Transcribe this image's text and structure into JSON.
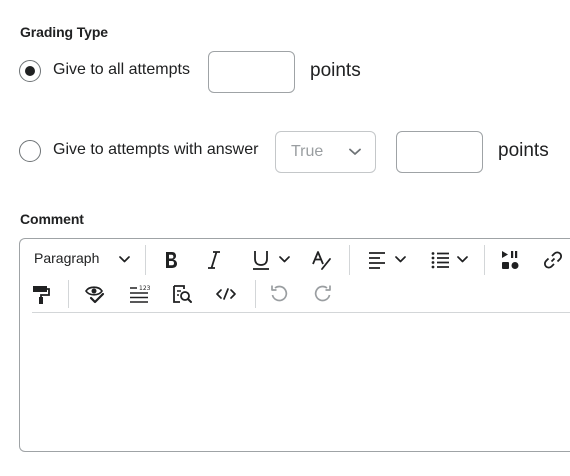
{
  "grading": {
    "title": "Grading Type",
    "options": [
      {
        "label": "Give to all attempts",
        "selected": true,
        "points_value": "",
        "points_unit": "points"
      },
      {
        "label": "Give to attempts with answer",
        "selected": false,
        "answer_select": "True",
        "points_value": "",
        "points_unit": "points"
      }
    ]
  },
  "comment": {
    "title": "Comment",
    "toolbar": {
      "paragraph_label": "Paragraph",
      "row1_icons": [
        "bold-icon",
        "italic-icon",
        "underline-icon",
        "format-clear-icon",
        "align-icon",
        "list-icon",
        "media-icon",
        "link-icon"
      ],
      "row2_icons": [
        "format-painter-icon",
        "accessibility-check-icon",
        "word-count-icon",
        "find-replace-icon",
        "source-code-icon",
        "undo-icon",
        "redo-icon"
      ]
    },
    "body": ""
  }
}
